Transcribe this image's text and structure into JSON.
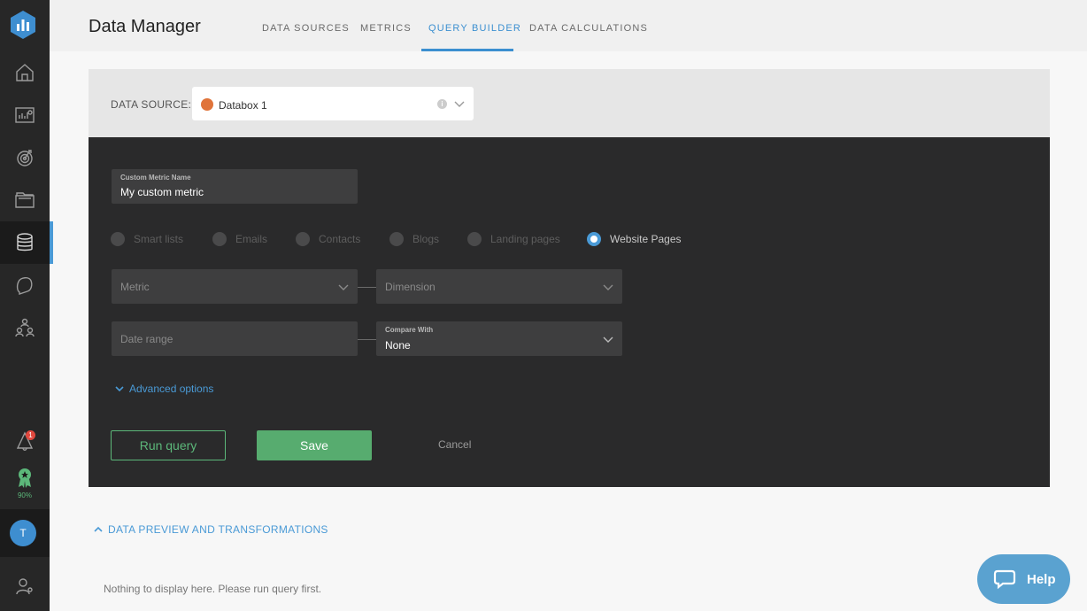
{
  "app": {
    "title": "Data Manager"
  },
  "header": {
    "tabs": [
      {
        "label": "DATA SOURCES"
      },
      {
        "label": "METRICS"
      },
      {
        "label": "QUERY BUILDER",
        "active": true
      },
      {
        "label": "DATA CALCULATIONS"
      }
    ]
  },
  "sidebar": {
    "icons": [
      "home-icon",
      "dashboard-icon",
      "goals-icon",
      "folder-icon",
      "database-icon",
      "alert-bubble-icon",
      "team-icon"
    ],
    "notification_count": "1",
    "score_percent": "90%",
    "user_initial": "T"
  },
  "datasource": {
    "label": "DATA SOURCE:",
    "value": "Databox 1"
  },
  "builder": {
    "metric_name": {
      "label": "Custom Metric Name",
      "value": "My custom metric"
    },
    "object_types": [
      {
        "label": "Smart lists",
        "checked": false
      },
      {
        "label": "Emails",
        "checked": false
      },
      {
        "label": "Contacts",
        "checked": false
      },
      {
        "label": "Blogs",
        "checked": false
      },
      {
        "label": "Landing pages",
        "checked": false
      },
      {
        "label": "Website Pages",
        "checked": true
      }
    ],
    "metric": {
      "placeholder": "Metric"
    },
    "dimension": {
      "placeholder": "Dimension"
    },
    "date_range": {
      "placeholder": "Date range"
    },
    "compare_with": {
      "label": "Compare With",
      "value": "None"
    },
    "advanced_options": "Advanced options",
    "run_query": "Run query",
    "save": "Save",
    "cancel": "Cancel"
  },
  "preview": {
    "toggle_label": "DATA PREVIEW AND TRANSFORMATIONS",
    "empty_message": "Nothing to display here. Please run query first."
  },
  "help": {
    "label": "Help"
  },
  "colors": {
    "accent_blue": "#4a9ad6",
    "success_green": "#57ac6f",
    "sidebar_bg": "#272727",
    "panel_dark": "#2a2a2b"
  }
}
